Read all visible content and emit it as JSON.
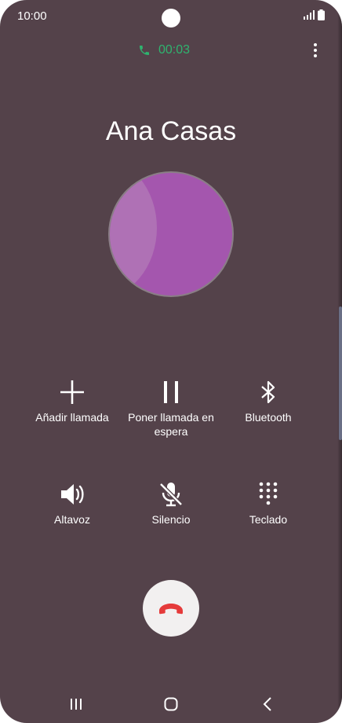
{
  "status_bar": {
    "time": "10:00",
    "icons": [
      "signal-icon",
      "battery-icon"
    ]
  },
  "call": {
    "timer": "00:03",
    "timer_color": "#2fb36f",
    "caller_name": "Ana Casas",
    "avatar_color": "#a456ae"
  },
  "controls": [
    {
      "label": "Añadir llamada",
      "icon": "add-call-icon"
    },
    {
      "label": "Poner llamada en espera",
      "icon": "pause-icon"
    },
    {
      "label": "Bluetooth",
      "icon": "bluetooth-icon"
    },
    {
      "label": "Altavoz",
      "icon": "speaker-icon"
    },
    {
      "label": "Silencio",
      "icon": "mute-microphone-icon"
    },
    {
      "label": "Teclado",
      "icon": "keypad-icon"
    }
  ],
  "end_call": {
    "icon": "end-call-icon",
    "color": "#e53a3a"
  },
  "navigation": {
    "buttons": [
      "recent-apps-icon",
      "home-icon",
      "back-icon"
    ]
  },
  "colors": {
    "background": "#54424a",
    "text": "#ffffff"
  }
}
